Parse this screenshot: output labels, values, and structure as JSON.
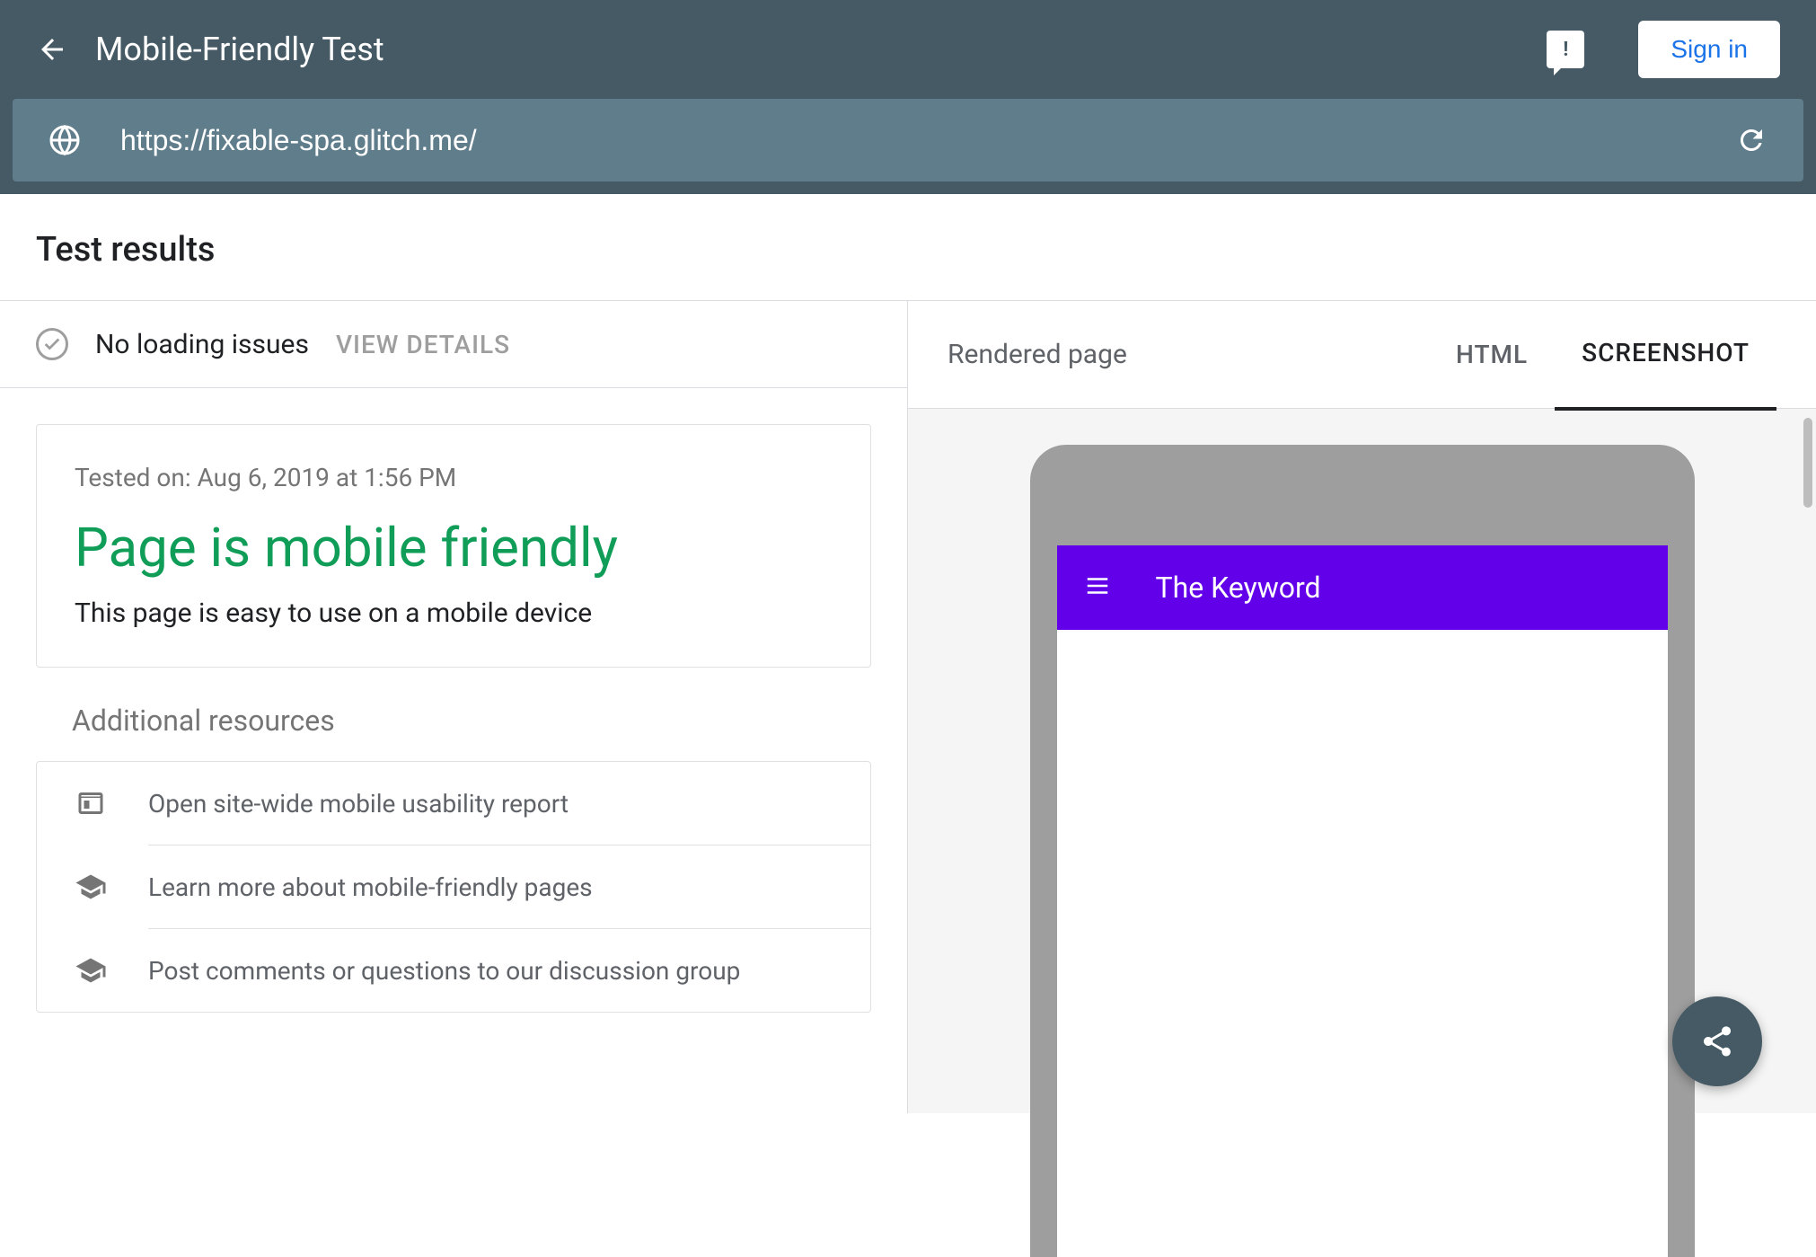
{
  "header": {
    "title": "Mobile-Friendly Test",
    "signin_label": "Sign in"
  },
  "url_bar": {
    "url": "https://fixable-spa.glitch.me/"
  },
  "section": {
    "title": "Test results"
  },
  "loading": {
    "status": "No loading issues",
    "details_label": "VIEW DETAILS"
  },
  "result": {
    "tested_on": "Tested on: Aug 6, 2019 at 1:56 PM",
    "headline": "Page is mobile friendly",
    "subtext": "This page is easy to use on a mobile device"
  },
  "resources": {
    "title": "Additional resources",
    "items": [
      {
        "label": "Open site-wide mobile usability report"
      },
      {
        "label": "Learn more about mobile-friendly pages"
      },
      {
        "label": "Post comments or questions to our discussion group"
      }
    ]
  },
  "right": {
    "rendered_label": "Rendered page",
    "tabs": {
      "html": "HTML",
      "screenshot": "SCREENSHOT"
    }
  },
  "phone": {
    "title": "The Keyword"
  }
}
